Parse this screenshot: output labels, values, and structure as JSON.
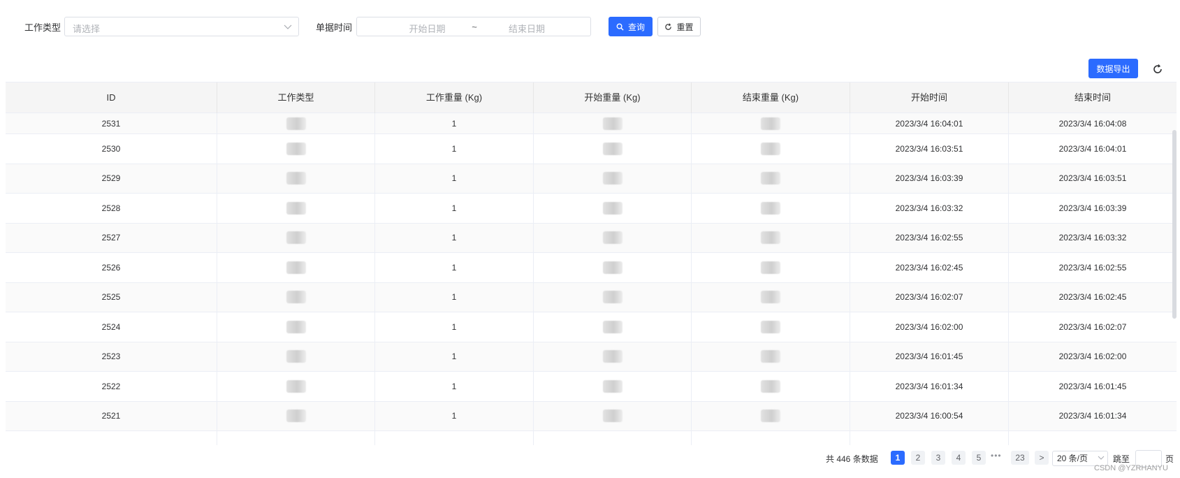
{
  "filters": {
    "work_type_label": "工作类型",
    "work_type_placeholder": "请选择",
    "time_label": "单据时间",
    "start_placeholder": "开始日期",
    "range_separator": "~",
    "end_placeholder": "结束日期",
    "query_label": "查询",
    "reset_label": "重置"
  },
  "toolbar": {
    "export_label": "数据导出"
  },
  "table": {
    "columns": [
      "ID",
      "工作类型",
      "工作重量 (Kg)",
      "开始重量 (Kg)",
      "结束重量 (Kg)",
      "开始时间",
      "结束时间"
    ],
    "rows": [
      {
        "id": "2531",
        "weight": "1",
        "start": "2023/3/4 16:04:01",
        "end": "2023/3/4 16:04:08"
      },
      {
        "id": "2530",
        "weight": "1",
        "start": "2023/3/4 16:03:51",
        "end": "2023/3/4 16:04:01"
      },
      {
        "id": "2529",
        "weight": "1",
        "start": "2023/3/4 16:03:39",
        "end": "2023/3/4 16:03:51"
      },
      {
        "id": "2528",
        "weight": "1",
        "start": "2023/3/4 16:03:32",
        "end": "2023/3/4 16:03:39"
      },
      {
        "id": "2527",
        "weight": "1",
        "start": "2023/3/4 16:02:55",
        "end": "2023/3/4 16:03:32"
      },
      {
        "id": "2526",
        "weight": "1",
        "start": "2023/3/4 16:02:45",
        "end": "2023/3/4 16:02:55"
      },
      {
        "id": "2525",
        "weight": "1",
        "start": "2023/3/4 16:02:07",
        "end": "2023/3/4 16:02:45"
      },
      {
        "id": "2524",
        "weight": "1",
        "start": "2023/3/4 16:02:00",
        "end": "2023/3/4 16:02:07"
      },
      {
        "id": "2523",
        "weight": "1",
        "start": "2023/3/4 16:01:45",
        "end": "2023/3/4 16:02:00"
      },
      {
        "id": "2522",
        "weight": "1",
        "start": "2023/3/4 16:01:34",
        "end": "2023/3/4 16:01:45"
      },
      {
        "id": "2521",
        "weight": "1",
        "start": "2023/3/4 16:00:54",
        "end": "2023/3/4 16:01:34"
      }
    ]
  },
  "pagination": {
    "total_text": "共 446 条数据",
    "pages": [
      "1",
      "2",
      "3",
      "4",
      "5"
    ],
    "ellipsis": "•••",
    "last_page": "23",
    "next": ">",
    "page_size": "20 条/页",
    "jump_label": "跳至",
    "page_suffix": "页",
    "current_page": 1
  },
  "watermark": "CSDN @YZRHANYU",
  "colors": {
    "primary": "#2b6bff",
    "header_bg": "#f5f5f5",
    "stripe": "#fafafa"
  }
}
